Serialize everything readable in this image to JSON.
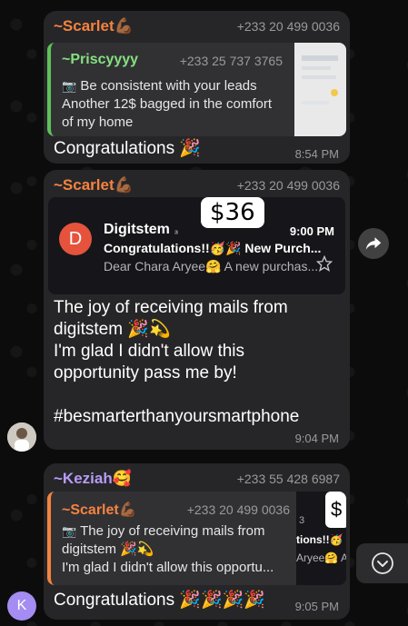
{
  "messages": [
    {
      "sender": "~Scarlet💪🏾",
      "phone": "+233 20 499 0036",
      "reply": {
        "name": "~Priscyyyy",
        "phone": "+233 25 737 3765",
        "line1": "Be consistent with your leads",
        "line2": "Another 12$ bagged in the comfort",
        "line3": "of my home"
      },
      "text": "Congratulations 🎉",
      "time": "8:54 PM"
    },
    {
      "sender": "~Scarlet💪🏾",
      "phone": "+233 20 499 0036",
      "email": {
        "avatar_letter": "D",
        "from": "Digitstem",
        "subject": "Congratulations!!🥳🎉 New Purch...",
        "preview": "Dear Chara Aryee🤗 A new purchas...",
        "time": "9:00 PM",
        "price_tag": "$36"
      },
      "lines": [
        "The joy of receiving mails from",
        "digitstem 🎉💫",
        "I'm glad I didn't allow this",
        "opportunity pass me by!",
        "",
        "#besmarterthanyoursmartphone"
      ],
      "time": "9:04 PM"
    },
    {
      "sender": "~Keziah🥰",
      "phone": "+233 55 428 6987",
      "reply": {
        "name": "~Scarlet💪🏾",
        "phone": "+233 20 499 0036",
        "line1": "The joy of receiving mails from",
        "line2": "digitstem 🎉💫",
        "line3": "I'm glad I didn't allow this opportu...",
        "thumb_text1": "3",
        "thumb_text2": "tions!!🥳",
        "thumb_text3": "Aryee🤗 A",
        "thumb_tag": "$"
      },
      "text": "Congratulations 🎉🎉🎉🎉",
      "time": "9:05 PM",
      "avatar_letter": "K"
    }
  ],
  "colors": {
    "scarlet": "#f5833f",
    "priscyyyy": "#86e07f",
    "keziah": "#b69cf7",
    "reply_green": "#5ec35a",
    "reply_orange": "#f5833f",
    "k_avatar": "#a48cf2"
  },
  "icons": {
    "camera": "camera-icon",
    "forward": "forward-icon",
    "chevron": "chevron-down-icon",
    "star": "star-icon"
  }
}
